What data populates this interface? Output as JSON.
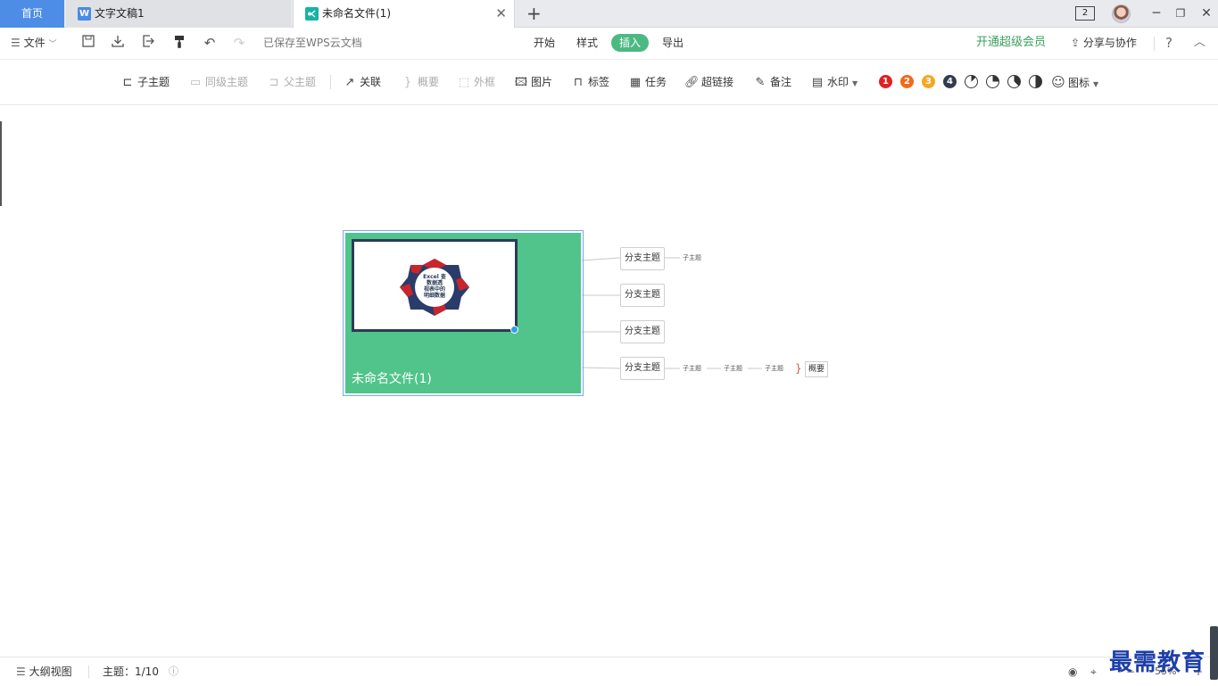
{
  "tabs": {
    "home": "首页",
    "doc": "文字文稿1",
    "mind": "未命名文件(1)",
    "doc_icon": "W",
    "window_badge": "2"
  },
  "menu": {
    "file": "文件",
    "saved_status": "已保存至WPS云文档",
    "tabs": [
      "开始",
      "样式",
      "插入",
      "导出"
    ],
    "active_tab": "插入",
    "vip": "开通超级会员",
    "share": "分享与协作"
  },
  "ribbon": {
    "child_topic": "子主题",
    "sibling_topic": "同级主题",
    "parent_topic": "父主题",
    "relation": "关联",
    "summary": "概要",
    "boundary": "外框",
    "image": "图片",
    "tag": "标签",
    "task": "任务",
    "hyperlink": "超链接",
    "note": "备注",
    "watermark": "水印",
    "icon": "图标",
    "priorities": [
      "1",
      "2",
      "3",
      "4"
    ]
  },
  "colors": {
    "root_fill": "#50c48b",
    "active_tab": "#4cb983",
    "home_tab": "#4d8de6",
    "vip_text": "#3aa05c",
    "priority_1": "#e02020",
    "priority_2": "#f06a1a",
    "priority_3": "#f5a623",
    "priority_4": "#333c4d"
  },
  "mindmap": {
    "root": "未命名文件(1)",
    "root_image_text": [
      "Excel 查",
      "数据透",
      "视表中的",
      "明细数据"
    ],
    "branches": [
      "分支主题",
      "分支主题",
      "分支主题",
      "分支主题"
    ],
    "sub_topic": "子主题",
    "summary": "概要"
  },
  "status": {
    "outline_view": "大纲视图",
    "topic_count": "主题：1/10",
    "zoom": "55%"
  },
  "watermark_text": "最需教育"
}
